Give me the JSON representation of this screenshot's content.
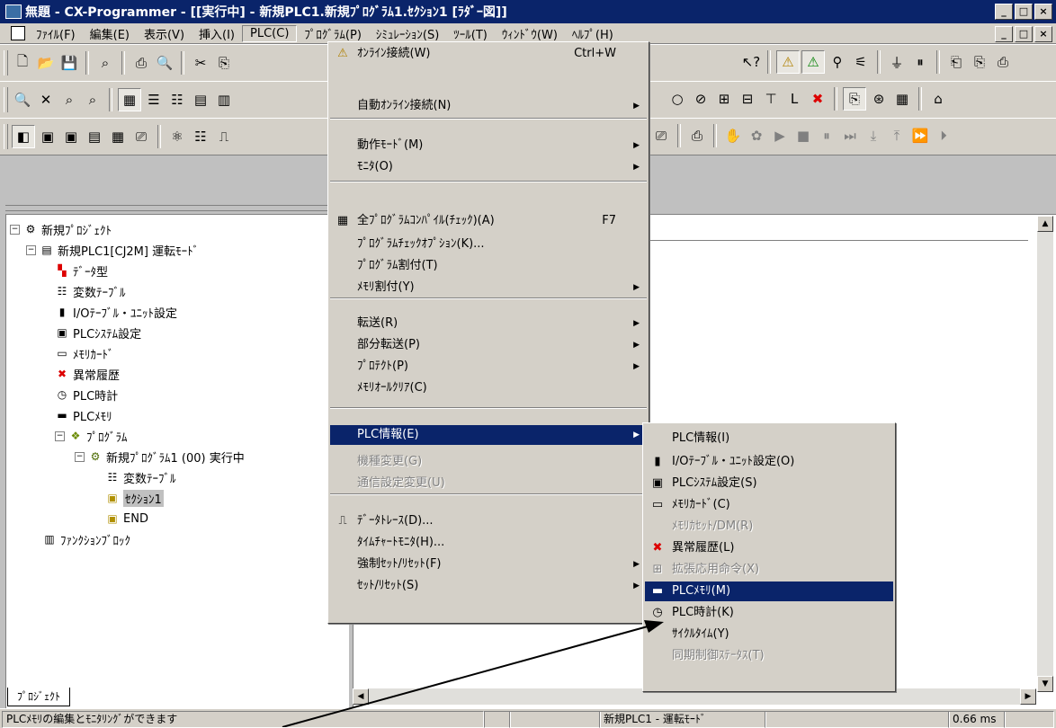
{
  "window": {
    "title": "無題 - CX-Programmer - [[実行中] - 新規PLC1.新規ﾌﾟﾛｸﾞﾗﾑ1.ｾｸｼｮﾝ1 [ﾗﾀﾞｰ図]]",
    "minimize": "_",
    "maximize": "□",
    "close": "×"
  },
  "menubar": {
    "items": [
      "ﾌｧｲﾙ(F)",
      "編集(E)",
      "表示(V)",
      "挿入(I)",
      "PLC(C)",
      "ﾌﾟﾛｸﾞﾗﾑ(P)",
      "ｼﾐｭﾚｰｼｮﾝ(S)",
      "ﾂｰﾙ(T)",
      "ｳｨﾝﾄﾞｳ(W)",
      "ﾍﾙﾌﾟ(H)"
    ],
    "open_item": "PLC(C)"
  },
  "plc_menu": {
    "items": [
      {
        "label": "ｵﾝﾗｲﾝ接続(W)",
        "shortcut": "Ctrl+W",
        "icon": "warning-icon"
      },
      {
        "label": "自動ｵﾝﾗｲﾝ接続(N)",
        "submenu": true
      },
      {
        "label": "動作ﾓｰﾄﾞ(M)",
        "submenu": true
      },
      {
        "label": "ﾓﾆﾀ(O)",
        "submenu": true
      },
      {
        "label": "全ﾌﾟﾛｸﾞﾗﾑｺﾝﾊﾟｲﾙ(ﾁｪｯｸ)(A)",
        "shortcut": "F7",
        "icon": "compile-icon"
      },
      {
        "label": "ﾌﾟﾛｸﾞﾗﾑﾁｪｯｸｵﾌﾟｼｮﾝ(K)..."
      },
      {
        "label": "ﾌﾟﾛｸﾞﾗﾑ割付(T)"
      },
      {
        "label": "ﾒﾓﾘ割付(Y)",
        "submenu": true
      },
      {
        "label": "転送(R)",
        "submenu": true
      },
      {
        "label": "部分転送(P)",
        "submenu": true
      },
      {
        "label": "ﾌﾟﾛﾃｸﾄ(P)",
        "submenu": true
      },
      {
        "label": "ﾒﾓﾘｵｰﾙｸﾘｱ(C)"
      },
      {
        "label": "PLC情報(E)",
        "submenu": true,
        "highlighted": true
      },
      {
        "label": "機種変更(G)",
        "disabled": true
      },
      {
        "label": "通信設定変更(U)",
        "disabled": true
      },
      {
        "label": "ﾃﾞｰﾀﾄﾚｰｽ(D)...",
        "icon": "trace-icon"
      },
      {
        "label": "ﾀｲﾑﾁｬｰﾄﾓﾆﾀ(H)..."
      },
      {
        "label": "強制ｾｯﾄ/ﾘｾｯﾄ(F)",
        "submenu": true
      },
      {
        "label": "ｾｯﾄ/ﾘｾｯﾄ(S)",
        "submenu": true
      }
    ]
  },
  "plc_info_submenu": {
    "items": [
      {
        "label": "PLC情報(I)"
      },
      {
        "label": "I/Oﾃｰﾌﾞﾙ・ﾕﾆｯﾄ設定(O)",
        "icon": "io-table-icon"
      },
      {
        "label": "PLCｼｽﾃﾑ設定(S)",
        "icon": "system-settings-icon"
      },
      {
        "label": "ﾒﾓﾘｶｰﾄﾞ(C)",
        "icon": "memory-card-icon"
      },
      {
        "label": "ﾒﾓﾘｶｾｯﾄ/DM(R)",
        "disabled": true
      },
      {
        "label": "異常履歴(L)",
        "icon": "error-log-icon"
      },
      {
        "label": "拡張応用命令(X)",
        "disabled": true,
        "icon": "extended-instruction-icon"
      },
      {
        "label": "PLCﾒﾓﾘ(M)",
        "highlighted": true,
        "icon": "memory-icon"
      },
      {
        "label": "PLC時計(K)",
        "icon": "clock-icon"
      },
      {
        "label": "ｻｲｸﾙﾀｲﾑ(Y)"
      },
      {
        "label": "同期制御ｽﾃｰﾀｽ(T)",
        "disabled": true
      }
    ]
  },
  "project_tree": [
    {
      "label": "新規ﾌﾟﾛｼﾞｪｸﾄ",
      "icon": "project-icon",
      "expander": "−"
    },
    {
      "label": "新規PLC1[CJ2M] 運転ﾓｰﾄﾞ",
      "icon": "plc-icon",
      "expander": "−"
    },
    {
      "label": "ﾃﾞｰﾀ型",
      "icon": "datatype-icon"
    },
    {
      "label": "変数ﾃｰﾌﾞﾙ",
      "icon": "variable-table-icon"
    },
    {
      "label": "I/Oﾃｰﾌﾞﾙ・ﾕﾆｯﾄ設定",
      "icon": "io-table-icon"
    },
    {
      "label": "PLCｼｽﾃﾑ設定",
      "icon": "system-settings-icon"
    },
    {
      "label": "ﾒﾓﾘｶｰﾄﾞ",
      "icon": "memory-card-icon"
    },
    {
      "label": "異常履歴",
      "icon": "error-log-icon"
    },
    {
      "label": "PLC時計",
      "icon": "clock-icon"
    },
    {
      "label": "PLCﾒﾓﾘ",
      "icon": "memory-icon"
    },
    {
      "label": "ﾌﾟﾛｸﾞﾗﾑ",
      "icon": "programs-icon",
      "expander": "−"
    },
    {
      "label": "新規ﾌﾟﾛｸﾞﾗﾑ1 (00) 実行中",
      "icon": "program-icon",
      "expander": "−"
    },
    {
      "label": "変数ﾃｰﾌﾞﾙ",
      "icon": "variable-table-icon"
    },
    {
      "label": "ｾｸｼｮﾝ1",
      "icon": "section-icon",
      "selected": true
    },
    {
      "label": "END",
      "icon": "section-icon"
    },
    {
      "label": "ﾌｧﾝｸｼｮﾝﾌﾞﾛｯｸ",
      "icon": "function-block-icon"
    }
  ],
  "project_tab": "ﾌﾟﾛｼﾞｪｸﾄ",
  "status": {
    "message": "PLCﾒﾓﾘの編集とﾓﾆﾀﾘﾝｸﾞができます",
    "plc_status": "新規PLC1 - 運転ﾓｰﾄﾞ",
    "cycle": "0.66 ms"
  },
  "colors": {
    "highlight": "#0a246a",
    "face": "#d4d0c8",
    "title": "#0a246a"
  }
}
